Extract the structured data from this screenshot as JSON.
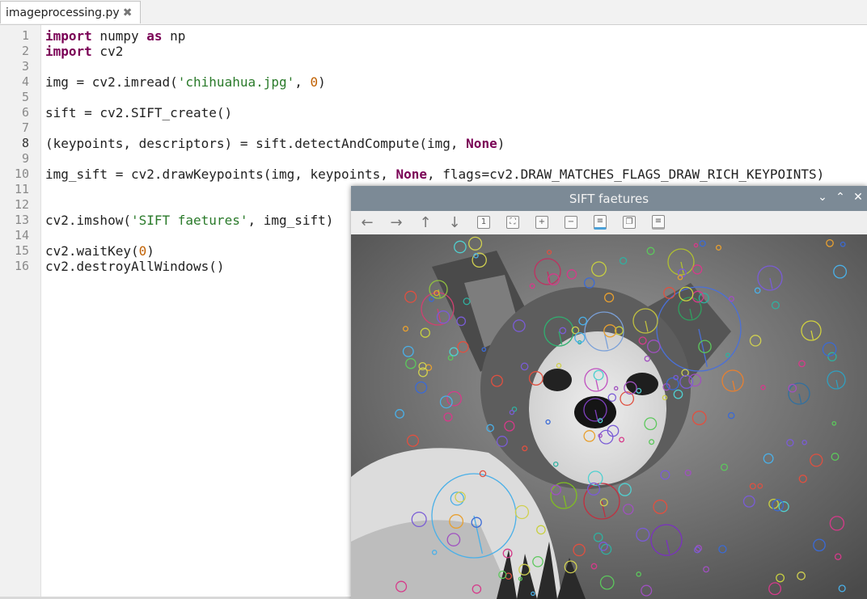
{
  "editor": {
    "tab_title": "imageprocessing.py",
    "tab_close": "✖",
    "current_line": 8,
    "lines": [
      {
        "n": "1",
        "tokens": [
          {
            "t": "import",
            "c": "kw"
          },
          {
            "t": " numpy ",
            "c": ""
          },
          {
            "t": "as",
            "c": "kw"
          },
          {
            "t": " np",
            "c": ""
          }
        ]
      },
      {
        "n": "2",
        "tokens": [
          {
            "t": "import",
            "c": "kw"
          },
          {
            "t": " cv2",
            "c": ""
          }
        ]
      },
      {
        "n": "3",
        "tokens": []
      },
      {
        "n": "4",
        "tokens": [
          {
            "t": "img = cv2.imread(",
            "c": ""
          },
          {
            "t": "'chihuahua.jpg'",
            "c": "str"
          },
          {
            "t": ", ",
            "c": ""
          },
          {
            "t": "0",
            "c": "num"
          },
          {
            "t": ")",
            "c": ""
          }
        ]
      },
      {
        "n": "5",
        "tokens": []
      },
      {
        "n": "6",
        "tokens": [
          {
            "t": "sift = cv2.SIFT_create()",
            "c": ""
          }
        ]
      },
      {
        "n": "7",
        "tokens": []
      },
      {
        "n": "8",
        "tokens": [
          {
            "t": "(keypoints, descriptors) = sift.detectAndCompute(img, ",
            "c": ""
          },
          {
            "t": "None",
            "c": "kw"
          },
          {
            "t": ")",
            "c": ""
          }
        ]
      },
      {
        "n": "9",
        "tokens": []
      },
      {
        "n": "10",
        "tokens": [
          {
            "t": "img_sift = cv2.drawKeypoints(img, keypoints, ",
            "c": ""
          },
          {
            "t": "None",
            "c": "kw"
          },
          {
            "t": ", flags=cv2.DRAW_MATCHES_FLAGS_DRAW_RICH_KEYPOINTS)",
            "c": ""
          }
        ]
      },
      {
        "n": "11",
        "tokens": []
      },
      {
        "n": "12",
        "tokens": []
      },
      {
        "n": "13",
        "tokens": [
          {
            "t": "cv2.imshow(",
            "c": ""
          },
          {
            "t": "'SIFT faetures'",
            "c": "str"
          },
          {
            "t": ", img_sift)",
            "c": ""
          }
        ]
      },
      {
        "n": "14",
        "tokens": []
      },
      {
        "n": "15",
        "tokens": [
          {
            "t": "cv2.waitKey(",
            "c": ""
          },
          {
            "t": "0",
            "c": "num"
          },
          {
            "t": ")",
            "c": ""
          }
        ]
      },
      {
        "n": "16",
        "tokens": [
          {
            "t": "cv2.destroyAllWindows()",
            "c": ""
          }
        ]
      }
    ]
  },
  "image_window": {
    "title": "SIFT faetures",
    "controls": {
      "minimize": "⌄",
      "maximize": "⌃",
      "close": "✕"
    },
    "toolbar": [
      {
        "name": "pan-left-icon",
        "glyph": "←"
      },
      {
        "name": "pan-right-icon",
        "glyph": "→"
      },
      {
        "name": "pan-up-icon",
        "glyph": "↑"
      },
      {
        "name": "pan-down-icon",
        "glyph": "↓"
      },
      {
        "name": "zoom-reset-icon",
        "glyph": "1"
      },
      {
        "name": "zoom-fit-icon",
        "glyph": "⛶"
      },
      {
        "name": "zoom-in-icon",
        "glyph": "+"
      },
      {
        "name": "zoom-out-icon",
        "glyph": "−"
      },
      {
        "name": "save-image-icon",
        "glyph": "≡"
      },
      {
        "name": "copy-image-icon",
        "glyph": "❐"
      },
      {
        "name": "properties-icon",
        "glyph": "≡"
      }
    ]
  }
}
